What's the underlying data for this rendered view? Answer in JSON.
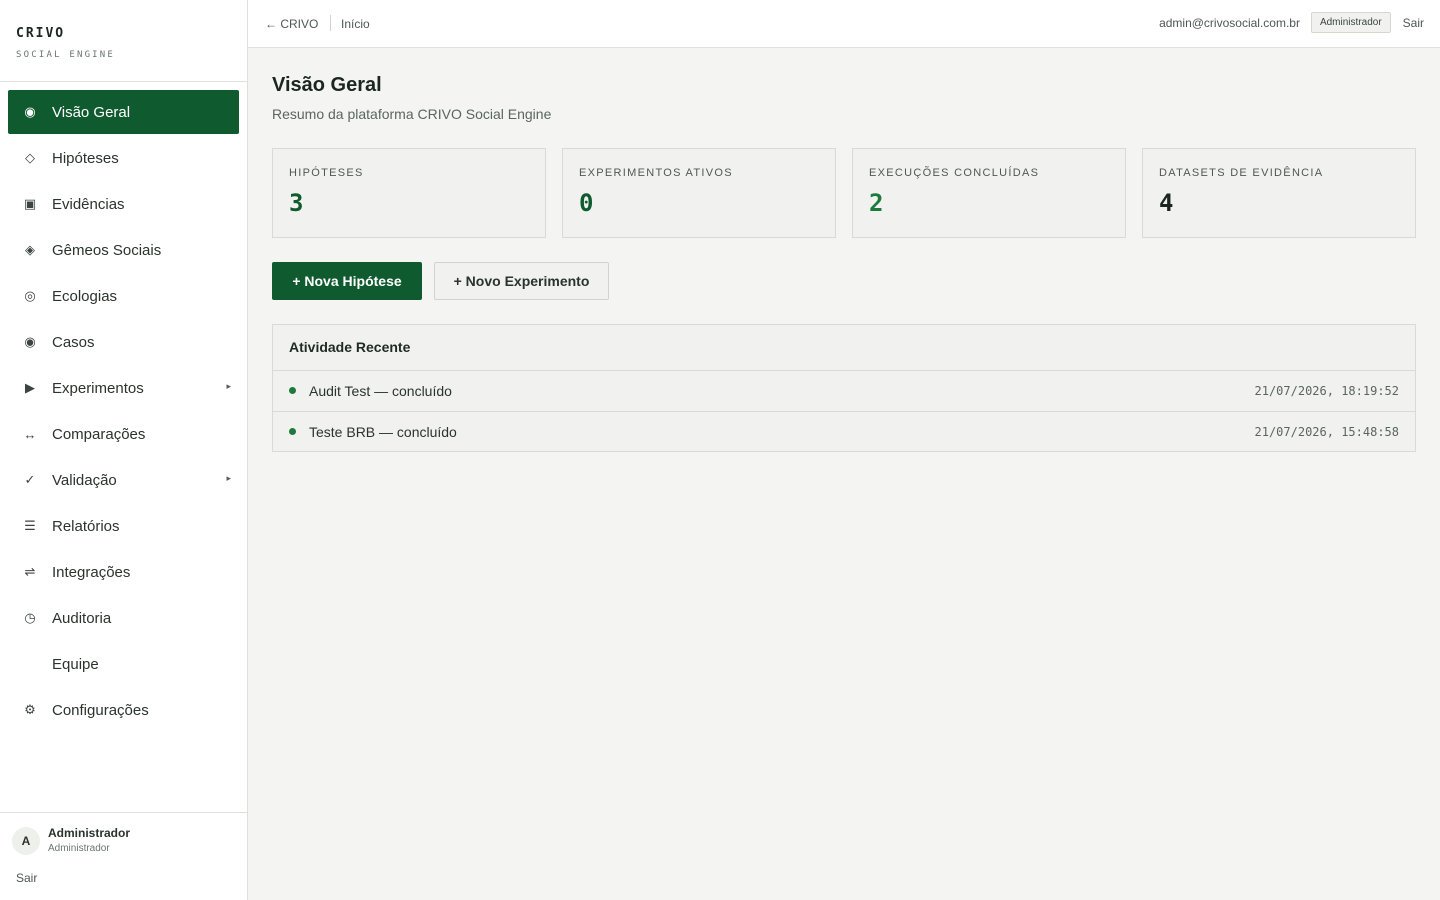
{
  "brand": {
    "title": "CRIVO",
    "subtitle": "SOCIAL ENGINE"
  },
  "sidebar": {
    "items": [
      {
        "label": "Visão Geral",
        "icon": "◉",
        "icon_name": "radio-icon",
        "active": true
      },
      {
        "label": "Hipóteses",
        "icon": "◇",
        "icon_name": "diamond-outline-icon"
      },
      {
        "label": "Evidências",
        "icon": "▣",
        "icon_name": "square-icon"
      },
      {
        "label": "Gêmeos Sociais",
        "icon": "◈",
        "icon_name": "diamond-filled-icon"
      },
      {
        "label": "Ecologias",
        "icon": "◎",
        "icon_name": "target-icon"
      },
      {
        "label": "Casos",
        "icon": "◉",
        "icon_name": "radio-icon"
      },
      {
        "label": "Experimentos",
        "icon": "▶",
        "icon_name": "play-icon",
        "arrow": "▸"
      },
      {
        "label": "Comparações",
        "icon": "↔",
        "icon_name": "arrows-icon"
      },
      {
        "label": "Validação",
        "icon": "✓",
        "icon_name": "check-icon",
        "arrow": "▸"
      },
      {
        "label": "Relatórios",
        "icon": "☰",
        "icon_name": "list-icon"
      },
      {
        "label": "Integrações",
        "icon": "⇌",
        "icon_name": "exchange-icon"
      },
      {
        "label": "Auditoria",
        "icon": "◷",
        "icon_name": "clock-icon"
      },
      {
        "label": "Equipe",
        "icon": "",
        "icon_name": ""
      },
      {
        "label": "Configurações",
        "icon": "⚙",
        "icon_name": "gear-icon"
      }
    ],
    "footer": {
      "avatar_initial": "A",
      "user_name": "Administrador",
      "user_role": "Administrador",
      "logout": "Sair"
    }
  },
  "topbar": {
    "back_link": "← CRIVO",
    "home_link": "Início",
    "email": "admin@crivosocial.com.br",
    "role_badge": "Administrador",
    "logout": "Sair"
  },
  "main": {
    "title": "Visão Geral",
    "subtitle": "Resumo da plataforma CRIVO Social Engine",
    "stats": [
      {
        "label": "HIPÓTESES",
        "value": "3",
        "color": "#0f5a2e"
      },
      {
        "label": "EXPERIMENTOS ATIVOS",
        "value": "0",
        "color": "#0f5a2e"
      },
      {
        "label": "EXECUÇÕES CONCLUÍDAS",
        "value": "2",
        "color": "#1c7a3a"
      },
      {
        "label": "DATASETS DE EVIDÊNCIA",
        "value": "4",
        "color": "#1b2620"
      }
    ],
    "buttons": {
      "new_hypothesis": "+ Nova Hipótese",
      "new_experiment": "+ Novo Experimento"
    },
    "activity": {
      "title": "Atividade Recente",
      "rows": [
        {
          "text": "Audit Test — concluído",
          "time": "21/07/2026, 18:19:52"
        },
        {
          "text": "Teste BRB — concluído",
          "time": "21/07/2026, 15:48:58"
        }
      ]
    }
  },
  "colors": {
    "accent": "#0f5a2e",
    "success_dot": "#1c7a3a"
  }
}
